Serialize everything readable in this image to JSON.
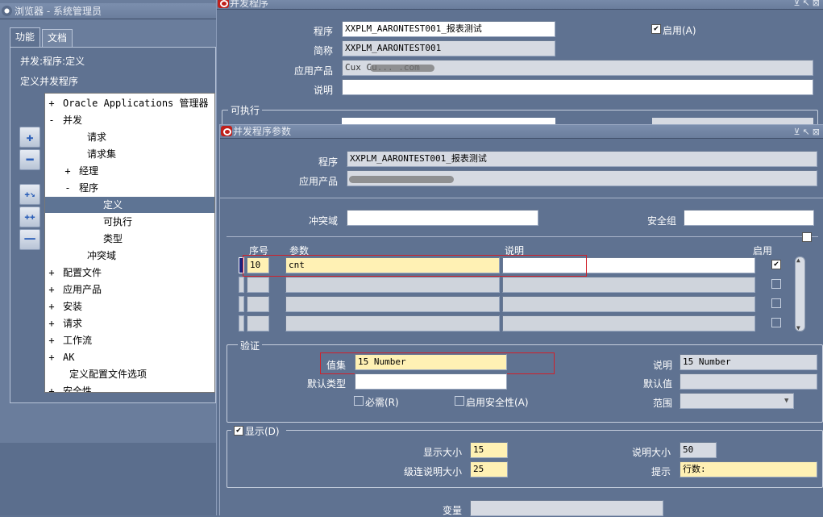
{
  "navigator": {
    "title": "浏览器 - 系统管理员",
    "tabs": [
      "功能",
      "文档"
    ],
    "path": "并发:程序:定义",
    "subtitle": "定义并发程序",
    "tree": [
      {
        "pm": "+",
        "label": "Oracle Applications 管理器"
      },
      {
        "pm": "-",
        "label": "并发"
      },
      {
        "pm": "",
        "label": "请求"
      },
      {
        "pm": "",
        "label": "请求集"
      },
      {
        "pm": "+",
        "label": "经理"
      },
      {
        "pm": "-",
        "label": "程序"
      },
      {
        "pm": "",
        "label": "定义"
      },
      {
        "pm": "",
        "label": "可执行"
      },
      {
        "pm": "",
        "label": "类型"
      },
      {
        "pm": "",
        "label": "冲突域"
      },
      {
        "pm": "+",
        "label": "配置文件"
      },
      {
        "pm": "+",
        "label": "应用产品"
      },
      {
        "pm": "+",
        "label": "安装"
      },
      {
        "pm": "+",
        "label": "请求"
      },
      {
        "pm": "+",
        "label": "工作流"
      },
      {
        "pm": "+",
        "label": "AK"
      },
      {
        "pm": "",
        "label": "定义配置文件选项"
      },
      {
        "pm": "+",
        "label": "安全性"
      }
    ]
  },
  "cp": {
    "title": "并发程序",
    "program_label": "程序",
    "program_value": "XXPLM_AARONTEST001_报表测试",
    "enabled_label": "启用(A)",
    "short_label": "简称",
    "short_value": "XXPLM_AARONTEST001",
    "app_label": "应用产品",
    "app_value": "Cux Cu... .com",
    "desc_label": "说明",
    "desc_value": "",
    "exec_group": "可执行"
  },
  "params": {
    "title": "并发程序参数",
    "program_label": "程序",
    "program_value": "XXPLM_AARONTEST001_报表测试",
    "app_label": "应用产品",
    "app_value": "",
    "conflict_label": "冲突域",
    "conflict_value": "",
    "secgroup_label": "安全组",
    "secgroup_value": "",
    "col_seq": "序号",
    "col_param": "参数",
    "col_desc": "说明",
    "col_enabled": "启用",
    "rows": [
      {
        "seq": "10",
        "param": "cnt",
        "desc": "",
        "enabled": true
      }
    ],
    "validation": {
      "group": "验证",
      "valueset_label": "值集",
      "valueset_value": "15 Number",
      "desc_label": "说明",
      "desc_value": "15 Number",
      "default_type_label": "默认类型",
      "default_type_value": "",
      "default_value_label": "默认值",
      "default_value_value": "",
      "required_label": "必需(R)",
      "security_label": "启用安全性(A)",
      "range_label": "范围",
      "range_value": ""
    },
    "display": {
      "group": "显示(D)",
      "display_size_label": "显示大小",
      "display_size_value": "15",
      "desc_size_label": "说明大小",
      "desc_size_value": "50",
      "concat_label": "级连说明大小",
      "concat_value": "25",
      "prompt_label": "提示",
      "prompt_value": "行数:"
    },
    "token_label": "变量",
    "token_value": ""
  }
}
